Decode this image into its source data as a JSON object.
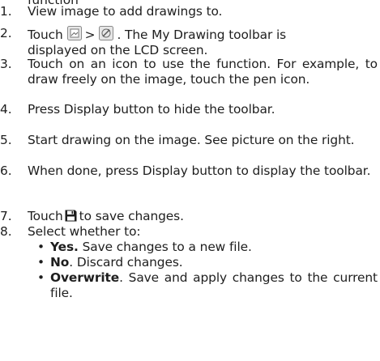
{
  "top_fragment": "function",
  "steps": [
    {
      "num": "1.",
      "text": "View image to add drawings to."
    },
    {
      "num": "2.",
      "before": "Touch",
      "sep": ">",
      "after": ". The My Drawing toolbar is",
      "line2": "displayed on the LCD screen."
    },
    {
      "num": "3.",
      "text": "Touch on an icon to use the function. For example, to draw freely on the image, touch the pen icon."
    },
    {
      "num": "4.",
      "text": "Press Display button to hide the toolbar."
    },
    {
      "num": "5.",
      "text": "Start drawing on the image. See picture on the right."
    },
    {
      "num": "6.",
      "text": "When done, press Display button to display the toolbar."
    },
    {
      "num": "7.",
      "before": "Touch",
      "after": "to save changes."
    },
    {
      "num": "8.",
      "text": "Select whether to:"
    }
  ],
  "options": [
    {
      "label": "Yes.",
      "desc": " Save changes to a new file."
    },
    {
      "label": "No",
      "desc": ". Discard changes."
    },
    {
      "label": "Overwrite",
      "desc": ". Save and apply changes to the current file."
    }
  ],
  "icons": {
    "step2_first": "image-menu-icon",
    "step2_second": "my-drawing-icon",
    "step7": "save-icon"
  },
  "colors": {
    "text": "#1e1e1e",
    "icon_border": "#8a8a8a",
    "icon_fill": "#e6e6e6"
  }
}
